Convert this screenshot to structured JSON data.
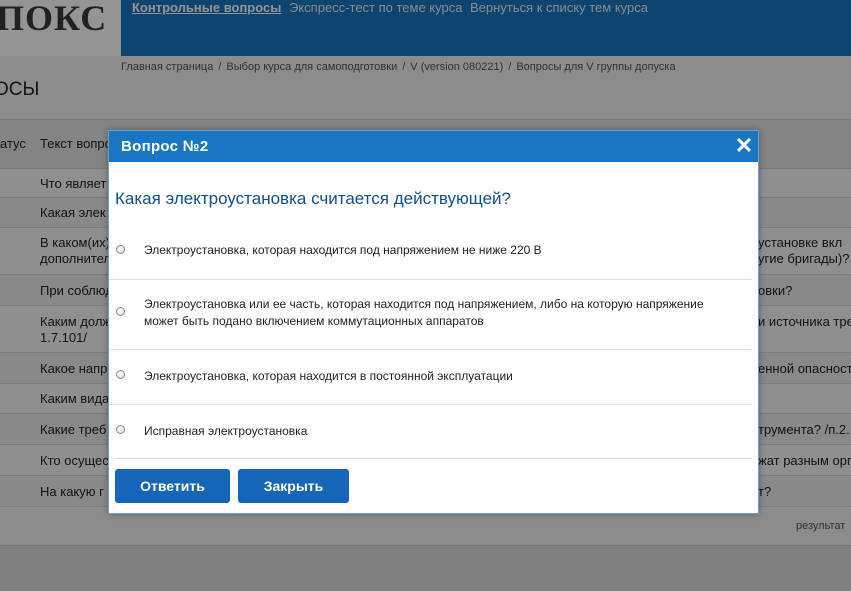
{
  "header": {
    "logo": "ПОКС",
    "nav": [
      {
        "label": "Контрольные вопросы",
        "active": true
      },
      {
        "label": "Экспресс-тест по теме курса",
        "active": false
      },
      {
        "label": "Вернуться к списку тем курса",
        "active": false
      }
    ]
  },
  "breadcrumb": [
    "Главная страница",
    "Выбор курса для самоподготовки",
    "V (version 080221)",
    "Вопросы для V группы допуска"
  ],
  "page_title": "ОСЫ",
  "table": {
    "headers": {
      "status": "атус",
      "text": "Текст вопро"
    },
    "rows": [
      {
        "left": "Что являет",
        "right": ""
      },
      {
        "left": "Какая элек",
        "right": ""
      },
      {
        "left": "В каком(их)",
        "left2": "дополнител",
        "right": "установке вкл",
        "right2": "угие бригады)?"
      },
      {
        "left": "При соблюд",
        "right": "овки?"
      },
      {
        "left": "Каким долж",
        "left2": "1.7.101/",
        "right": "и источника тре"
      },
      {
        "left": "Какое напр",
        "right": "енной опасност"
      },
      {
        "left": "Каким вида",
        "right": ""
      },
      {
        "left": "Какие треб",
        "right": "трумента? /п.2."
      },
      {
        "left": "Кто осущес",
        "right": "жат разным орг"
      },
      {
        "left": "На какую г",
        "right": "т?"
      }
    ],
    "results_label": "результат"
  },
  "modal": {
    "title": "Вопрос №2",
    "close_label": "✕",
    "question": "Какая электроустановка считается действующей?",
    "options": [
      "Электроустановка, которая находится под напряжением не ниже 220 В",
      "Электроустановка или ее часть, которая находится под напряжением, либо на которую напряжение может быть подано включением коммутационных аппаратов",
      "Электроустановка, которая находится в постоянной эксплуатации",
      "Исправная электроустановка"
    ],
    "buttons": {
      "answer": "Ответить",
      "close": "Закрыть"
    }
  },
  "colors": {
    "accent": "#1976c2",
    "button": "#1565b8",
    "question_text": "#0f4f8c"
  }
}
